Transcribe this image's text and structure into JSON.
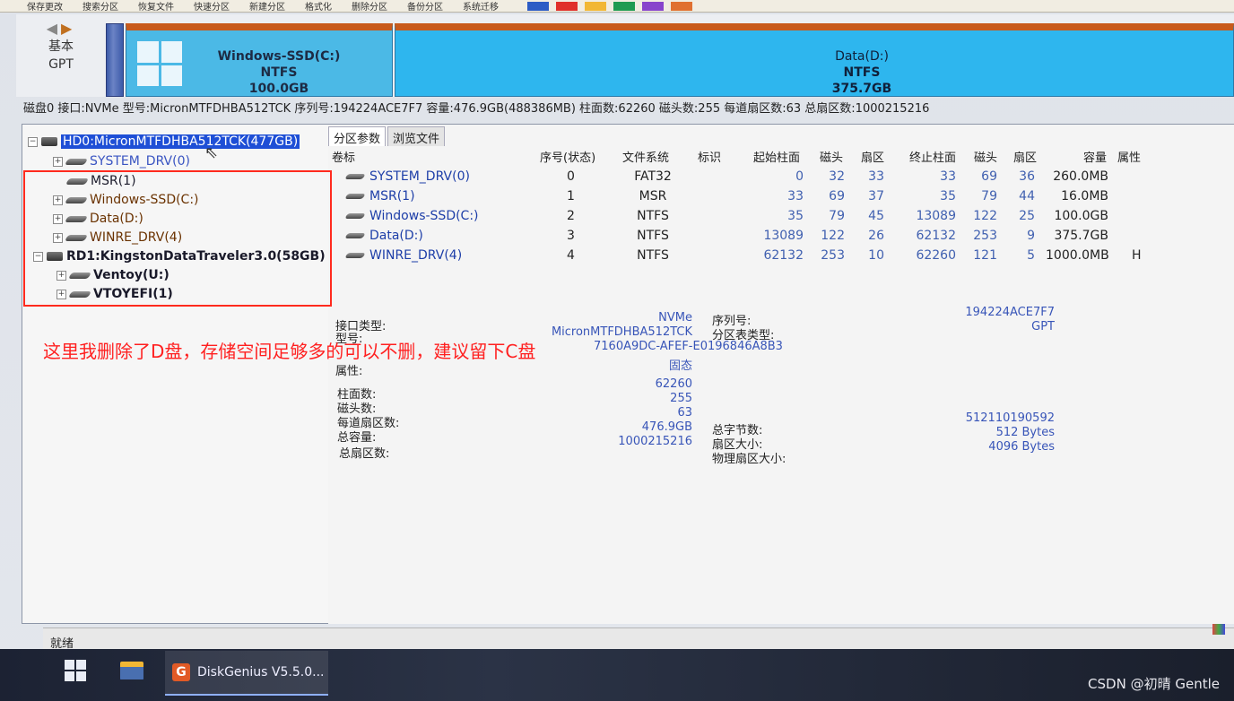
{
  "toolbar": {
    "items": [
      "保存更改",
      "搜索分区",
      "恢复文件",
      "快速分区",
      "新建分区",
      "格式化",
      "删除分区",
      "备份分区",
      "系统迁移"
    ],
    "colors": [
      "#2c5cc5",
      "#e0302a",
      "#f2b734",
      "#1f9b52",
      "#8844cc",
      "#e07030"
    ]
  },
  "diskmap": {
    "nav_label_1": "基本",
    "nav_label_2": "GPT",
    "win_name": "Windows-SSD(C:)",
    "win_fs": "NTFS",
    "win_size": "100.0GB",
    "data_name": "Data(D:)",
    "data_fs": "NTFS",
    "data_size": "375.7GB"
  },
  "infoline": "磁盘0 接口:NVMe  型号:MicronMTFDHBA512TCK  序列号:194224ACE7F7  容量:476.9GB(488386MB)  柱面数:62260  磁头数:255  每道扇区数:63  总扇区数:1000215216",
  "tree": {
    "disk0": "HD0:MicronMTFDHBA512TCK(477GB)",
    "items": [
      {
        "label": "SYSTEM_DRV(0)"
      },
      {
        "label": "MSR(1)"
      },
      {
        "label": "Windows-SSD(C:)"
      },
      {
        "label": "Data(D:)"
      },
      {
        "label": "WINRE_DRV(4)"
      }
    ],
    "disk1": "RD1:KingstonDataTraveler3.0(58GB)",
    "items2": [
      {
        "label": "Ventoy(U:)"
      },
      {
        "label": "VTOYEFI(1)"
      }
    ]
  },
  "tabs": [
    "分区参数",
    "浏览文件"
  ],
  "table": {
    "headers": [
      "卷标",
      "序号(状态)",
      "文件系统",
      "标识",
      "起始柱面",
      "磁头",
      "扇区",
      "终止柱面",
      "磁头",
      "扇区",
      "容量",
      "属性"
    ],
    "rows": [
      {
        "name": "SYSTEM_DRV(0)",
        "idx": "0",
        "fs": "FAT32",
        "sc": "0",
        "sh": "32",
        "ss": "33",
        "ec": "33",
        "eh": "69",
        "es": "36",
        "cap": "260.0MB",
        "attr": ""
      },
      {
        "name": "MSR(1)",
        "idx": "1",
        "fs": "MSR",
        "sc": "33",
        "sh": "69",
        "ss": "37",
        "ec": "35",
        "eh": "79",
        "es": "44",
        "cap": "16.0MB",
        "attr": ""
      },
      {
        "name": "Windows-SSD(C:)",
        "idx": "2",
        "fs": "NTFS",
        "sc": "35",
        "sh": "79",
        "ss": "45",
        "ec": "13089",
        "eh": "122",
        "es": "25",
        "cap": "100.0GB",
        "attr": ""
      },
      {
        "name": "Data(D:)",
        "idx": "3",
        "fs": "NTFS",
        "sc": "13089",
        "sh": "122",
        "ss": "26",
        "ec": "62132",
        "eh": "253",
        "es": "9",
        "cap": "375.7GB",
        "attr": ""
      },
      {
        "name": "WINRE_DRV(4)",
        "idx": "4",
        "fs": "NTFS",
        "sc": "62132",
        "sh": "253",
        "ss": "10",
        "ec": "62260",
        "eh": "121",
        "es": "5",
        "cap": "1000.0MB",
        "attr": "H"
      }
    ]
  },
  "details": {
    "interface_label": "接口类型:",
    "interface_value": "NVMe",
    "model_label": "型号:",
    "model_value": "MicronMTFDHBA512TCK",
    "guid_value": "7160A9DC-AFEF-E0196846A8B3",
    "serial_label": "序列号:",
    "serial_value": "194224ACE7F7",
    "ptable_label": "分区表类型:",
    "ptable_value": "GPT",
    "attr_label": "属性:",
    "attr_value": "固态",
    "cyl_label": "柱面数:",
    "cyl_value": "62260",
    "heads_label": "磁头数:",
    "heads_value": "255",
    "spt_label": "每道扇区数:",
    "spt_value": "63",
    "cap_label": "总容量:",
    "cap_value": "476.9GB",
    "tsec_label": "总扇区数:",
    "tsec_value": "1000215216",
    "tbytes_label": "总字节数:",
    "tbytes_value": "512110190592",
    "secsize_label": "扇区大小:",
    "secsize_value": "512 Bytes",
    "physsec_label": "物理扇区大小:",
    "physsec_value": "4096 Bytes"
  },
  "annotation": "这里我删除了D盘，存储空间足够多的可以不删，建议留下C盘",
  "status": "就绪",
  "taskbar": {
    "app_label": "DiskGenius V5.5.0...",
    "app_icon_letter": "G"
  },
  "watermark": "CSDN @初晴 Gentle"
}
